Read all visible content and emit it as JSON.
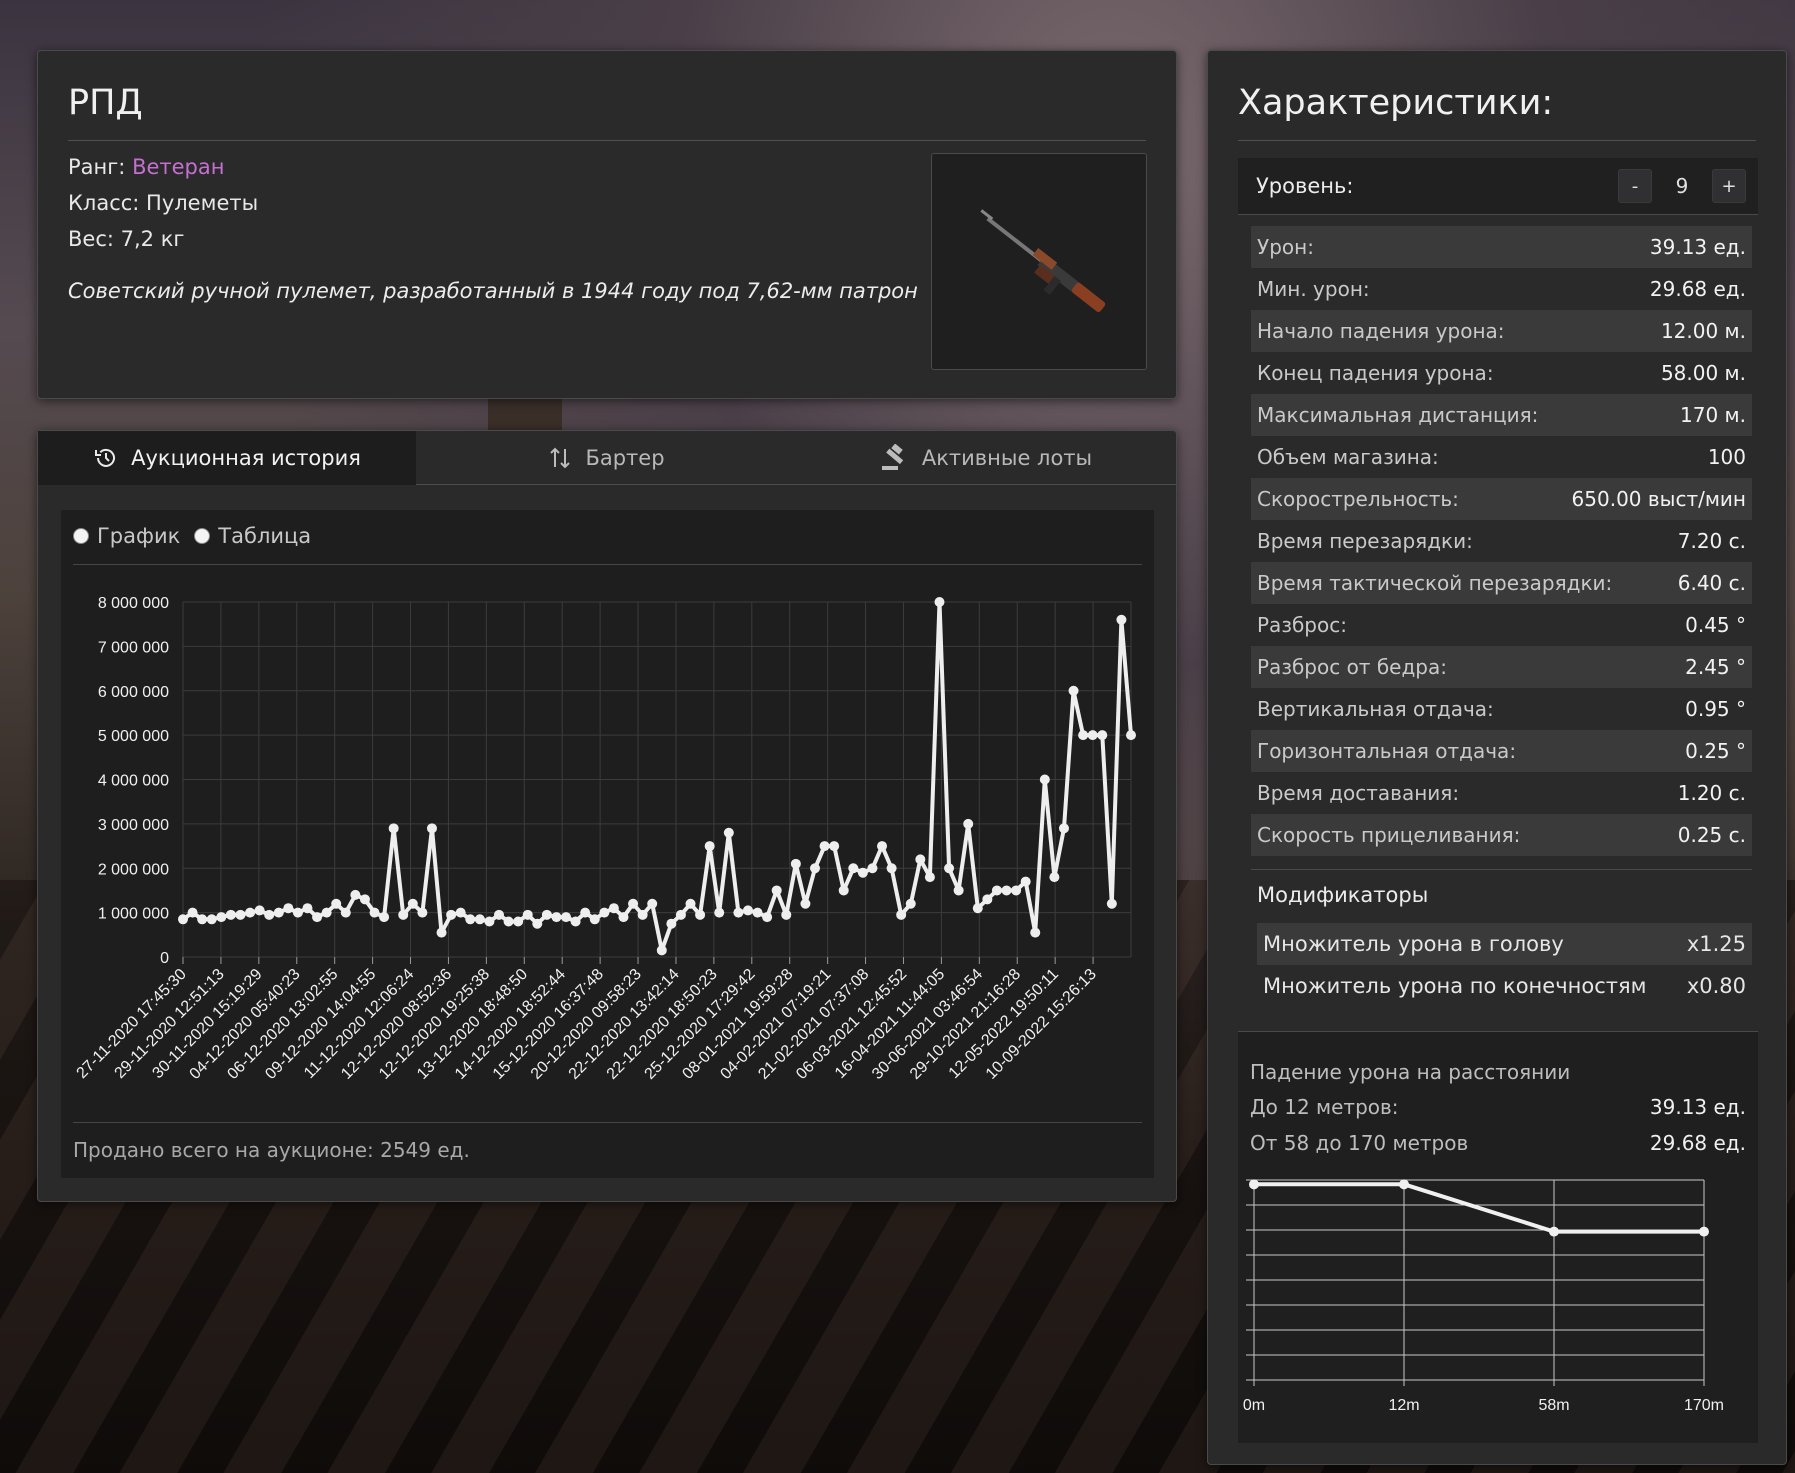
{
  "item": {
    "name": "РПД",
    "rank_label": "Ранг:",
    "rank_value": "Ветеран",
    "rank_color": "#c56fd0",
    "class_text": "Класс: Пулеметы",
    "weight_text": "Вес: 7,2 кг",
    "description": "Советский ручной пулемет, разработанный в 1944 году под 7,62-мм патрон",
    "image_icon": "rpd-machine-gun-image"
  },
  "tabs": [
    {
      "label": "Аукционная история",
      "icon": "history-icon",
      "active": true
    },
    {
      "label": "Бартер",
      "icon": "swap-arrows-icon",
      "active": false
    },
    {
      "label": "Активные лоты",
      "icon": "gavel-icon",
      "active": false
    }
  ],
  "view_options": [
    "График",
    "Таблица"
  ],
  "sold_total": "Продано всего на аукционе: 2549 ед.",
  "chart_data": [
    {
      "type": "line",
      "title": "",
      "xlabel": "",
      "ylabel": "",
      "ylim": [
        0,
        8000000
      ],
      "yticks": [
        "0",
        "1 000 000",
        "2 000 000",
        "3 000 000",
        "4 000 000",
        "5 000 000",
        "6 000 000",
        "7 000 000",
        "8 000 000"
      ],
      "grid": true,
      "line_color": "#eeeeee",
      "xtick_labels": [
        "27-11-2020 17:45:30",
        "29-11-2020 12:51:13",
        "30-11-2020 15:19:29",
        "04-12-2020 05:40:23",
        "06-12-2020 13:02:55",
        "09-12-2020 14:04:55",
        "11-12-2020 12:06:24",
        "12-12-2020 08:52:36",
        "12-12-2020 19:25:38",
        "13-12-2020 18:48:50",
        "14-12-2020 18:52:44",
        "15-12-2020 16:37:48",
        "20-12-2020 09:58:23",
        "22-12-2020 13:42:14",
        "22-12-2020 18:50:23",
        "25-12-2020 17:29:42",
        "08-01-2021 19:59:28",
        "04-02-2021 07:19:21",
        "21-02-2021 07:37:08",
        "06-03-2021 12:45:52",
        "16-04-2021 11:44:05",
        "30-06-2021 03:46:54",
        "29-10-2021 21:16:28",
        "12-05-2022 19:50:11",
        "10-09-2022 15:26:13"
      ],
      "values": [
        850000,
        1000000,
        850000,
        850000,
        900000,
        950000,
        950000,
        1000000,
        1050000,
        950000,
        1000000,
        1100000,
        1000000,
        1100000,
        900000,
        1000000,
        1200000,
        1000000,
        1400000,
        1300000,
        1000000,
        900000,
        2900000,
        950000,
        1200000,
        1000000,
        2900000,
        550000,
        950000,
        1000000,
        850000,
        850000,
        800000,
        950000,
        800000,
        800000,
        950000,
        750000,
        950000,
        900000,
        900000,
        800000,
        1000000,
        850000,
        1000000,
        1100000,
        900000,
        1200000,
        950000,
        1200000,
        150000,
        750000,
        950000,
        1200000,
        950000,
        2500000,
        1000000,
        2800000,
        1000000,
        1050000,
        1000000,
        900000,
        1500000,
        950000,
        2100000,
        1200000,
        2000000,
        2500000,
        2500000,
        1500000,
        2000000,
        1900000,
        2000000,
        2500000,
        2000000,
        950000,
        1200000,
        2200000,
        1800000,
        8000000,
        2000000,
        1500000,
        3000000,
        1100000,
        1300000,
        1500000,
        1500000,
        1500000,
        1700000,
        550000,
        4000000,
        1800000,
        2900000,
        6000000,
        5000000,
        5000000,
        5000000,
        1200000,
        7600000,
        5000000
      ]
    },
    {
      "type": "line",
      "title": "",
      "x_categories": [
        "0m",
        "12m",
        "58m",
        "170m"
      ],
      "values": [
        39.13,
        39.13,
        29.68,
        29.68
      ],
      "ylim": [
        0,
        40
      ],
      "grid": true,
      "line_color": "#f0f0f0"
    }
  ],
  "stats": {
    "title": "Характеристики:",
    "level_label": "Уровень:",
    "level_value": "9",
    "minus_label": "-",
    "plus_label": "+",
    "rows": [
      {
        "k": "Урон:",
        "v": "39.13 ед."
      },
      {
        "k": "Мин. урон:",
        "v": "29.68 ед."
      },
      {
        "k": "Начало падения урона:",
        "v": "12.00 м."
      },
      {
        "k": "Конец падения урона:",
        "v": "58.00 м."
      },
      {
        "k": "Максимальная дистанция:",
        "v": "170 м."
      },
      {
        "k": "Объем магазина:",
        "v": "100"
      },
      {
        "k": "Скорострельность:",
        "v": "650.00 выст/мин"
      },
      {
        "k": "Время перезарядки:",
        "v": "7.20 с."
      },
      {
        "k": "Время тактической перезарядки:",
        "v": "6.40 с."
      },
      {
        "k": "Разброс:",
        "v": "0.45 °"
      },
      {
        "k": "Разброс от бедра:",
        "v": "2.45 °"
      },
      {
        "k": "Вертикальная отдача:",
        "v": "0.95 °"
      },
      {
        "k": "Горизонтальная отдача:",
        "v": "0.25 °"
      },
      {
        "k": "Время доставания:",
        "v": "1.20 с."
      },
      {
        "k": "Скорость прицеливания:",
        "v": "0.25 с."
      }
    ],
    "modifiers_title": "Модификаторы",
    "modifiers": [
      {
        "k": "Множитель урона в голову",
        "v": "x1.25"
      },
      {
        "k": "Множитель урона по конечностям",
        "v": "x0.80"
      }
    ]
  },
  "falloff": {
    "title": "Падение урона на расстоянии",
    "rows": [
      {
        "k": "До 12 метров:",
        "v": "39.13 ед."
      },
      {
        "k": "От 58 до 170 метров",
        "v": "29.68 ед."
      }
    ]
  }
}
